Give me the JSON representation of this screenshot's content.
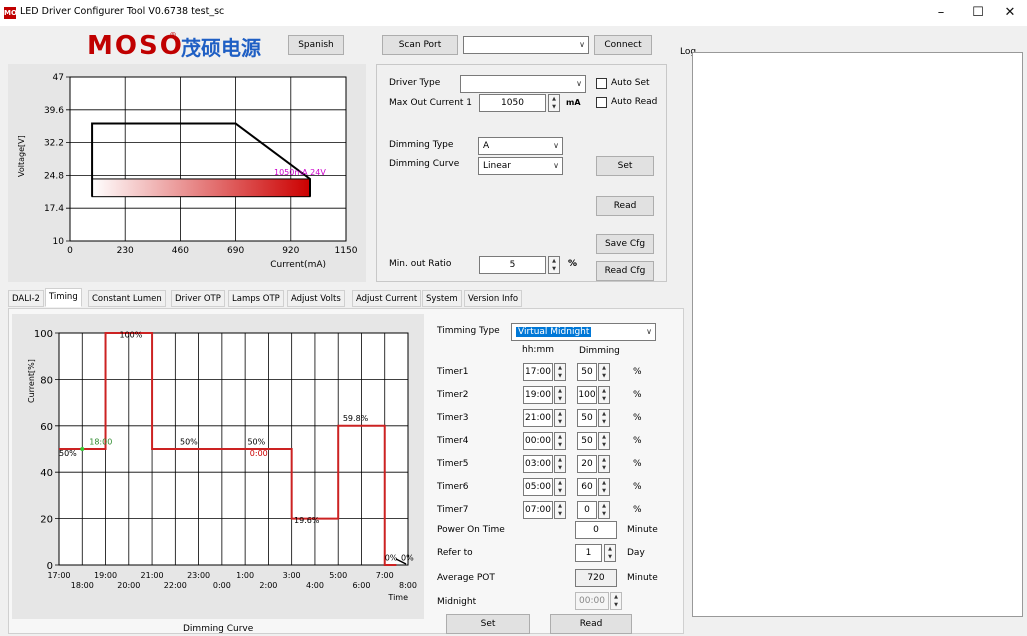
{
  "window": {
    "title": "LED Driver Configurer Tool V0.6738  test_sc",
    "app_icon": "MOSO",
    "min": "–",
    "max": "☐",
    "close": "✕"
  },
  "brand": {
    "logo": "MOSO",
    "reg": "®",
    "chinese": "茂硕电源"
  },
  "top": {
    "language_button": "Spanish",
    "scan_port_button": "Scan Port",
    "port_value": "",
    "connect_button": "Connect"
  },
  "log": {
    "label": "Log"
  },
  "driver": {
    "driver_type_label": "Driver Type",
    "driver_type_value": "",
    "auto_set_label": "Auto Set",
    "max_out_label": "Max Out Current 1",
    "max_out_value": "1050",
    "max_out_unit": "mA",
    "auto_read_label": "Auto Read",
    "dimming_type_label": "Dimming Type",
    "dimming_type_value": "A",
    "dimming_curve_label": "Dimming Curve",
    "dimming_curve_value": "Linear",
    "set_button": "Set",
    "read_button": "Read",
    "save_cfg_button": "Save Cfg",
    "read_cfg_button": "Read Cfg",
    "min_ratio_label": "Min. out Ratio",
    "min_ratio_value": "5",
    "min_ratio_unit": "%"
  },
  "tabs": [
    "DALI-2",
    "Timing",
    "Constant Lumen",
    "Driver OTP",
    "Lamps OTP",
    "Adjust Volts",
    "Adjust Current",
    "System",
    "Version Info"
  ],
  "timing": {
    "timing_type_label": "Timming Type",
    "timing_type_value": "Virtual Midnight",
    "col_time": "hh:mm",
    "col_dimming": "Dimming",
    "timers": [
      {
        "label": "Timer1",
        "time": "17:00",
        "dim": "50",
        "unit": "%"
      },
      {
        "label": "Timer2",
        "time": "19:00",
        "dim": "100",
        "unit": "%"
      },
      {
        "label": "Timer3",
        "time": "21:00",
        "dim": "50",
        "unit": "%"
      },
      {
        "label": "Timer4",
        "time": "00:00",
        "dim": "50",
        "unit": "%"
      },
      {
        "label": "Timer5",
        "time": "03:00",
        "dim": "20",
        "unit": "%"
      },
      {
        "label": "Timer6",
        "time": "05:00",
        "dim": "60",
        "unit": "%"
      },
      {
        "label": "Timer7",
        "time": "07:00",
        "dim": "0",
        "unit": "%"
      }
    ],
    "power_on_label": "Power On Time",
    "power_on_value": "0",
    "power_on_unit": "Minute",
    "refer_label": "Refer to",
    "refer_value": "1",
    "refer_unit": "Day",
    "avg_pot_label": "Average POT",
    "avg_pot_value": "720",
    "avg_pot_unit": "Minute",
    "midnight_label": "Midnight",
    "midnight_value": "00:00",
    "set_button": "Set",
    "read_button": "Read"
  },
  "chart_data": [
    {
      "type": "line",
      "title": "",
      "xlabel": "Current(mA)",
      "ylabel": "Voltage[V]",
      "x_ticks": [
        "0",
        "230",
        "460",
        "690",
        "920",
        "1150"
      ],
      "y_ticks": [
        "47",
        "39.6",
        "32.2",
        "24.8",
        "17.4",
        "10"
      ],
      "xlim": [
        0,
        1150
      ],
      "ylim": [
        10,
        47
      ],
      "grid": true,
      "envelope": {
        "x": [
          92,
          92,
          690,
          1000,
          1000
        ],
        "y": [
          20,
          36.5,
          36.5,
          24,
          20
        ]
      },
      "operating_bar": {
        "x_start": 92,
        "x_end": 1000,
        "y_low": 20,
        "y_high": 24
      },
      "annotation": "1050mA 24V",
      "colors": {
        "envelope": "#000000",
        "bar_start": "#ffffff",
        "bar_end": "#cc0000",
        "annotation": "#cc00cc"
      }
    },
    {
      "type": "line",
      "title": "Dimming Curve",
      "xlabel": "Time",
      "ylabel": "Current[%]",
      "x_ticks_upper": [
        "17:00",
        "19:00",
        "21:00",
        "23:00",
        "1:00",
        "3:00",
        "5:00",
        "7:00"
      ],
      "x_ticks_lower": [
        "18:00",
        "20:00",
        "22:00",
        "0:00",
        "2:00",
        "4:00",
        "6:00",
        "8:00"
      ],
      "y_ticks": [
        "100",
        "80",
        "60",
        "40",
        "20",
        "0"
      ],
      "ylim": [
        0,
        100
      ],
      "xlim_hours": [
        17,
        32
      ],
      "grid": true,
      "series": [
        {
          "x_hours": [
            17,
            19,
            19,
            21,
            21,
            27,
            27,
            29,
            29,
            31,
            31,
            31.5
          ],
          "values": [
            50,
            50,
            100,
            100,
            50,
            50,
            20,
            20,
            60,
            60,
            0,
            0
          ]
        }
      ],
      "labels": [
        {
          "text": "50%",
          "x": 17,
          "y": 47,
          "color": "#000000"
        },
        {
          "text": "18:00",
          "x": 18.3,
          "y": 52,
          "color": "#2e8b2e"
        },
        {
          "text": "100%",
          "x": 19.6,
          "y": 98,
          "color": "#000000"
        },
        {
          "text": "50%",
          "x": 22.2,
          "y": 52,
          "color": "#000000"
        },
        {
          "text": "50%",
          "x": 25.1,
          "y": 52,
          "color": "#000000"
        },
        {
          "text": "0:00",
          "x": 25.2,
          "y": 47,
          "color": "#cc0000"
        },
        {
          "text": "19.6%",
          "x": 27.1,
          "y": 18,
          "color": "#000000"
        },
        {
          "text": "59.8%",
          "x": 29.2,
          "y": 62,
          "color": "#000000"
        },
        {
          "text": "0%",
          "x": 31.0,
          "y": 2,
          "color": "#000000"
        },
        {
          "text": "0%",
          "x": 31.7,
          "y": 2,
          "color": "#000000"
        }
      ],
      "colors": {
        "line": "#cc2222",
        "marker": "#33cc33"
      }
    }
  ]
}
